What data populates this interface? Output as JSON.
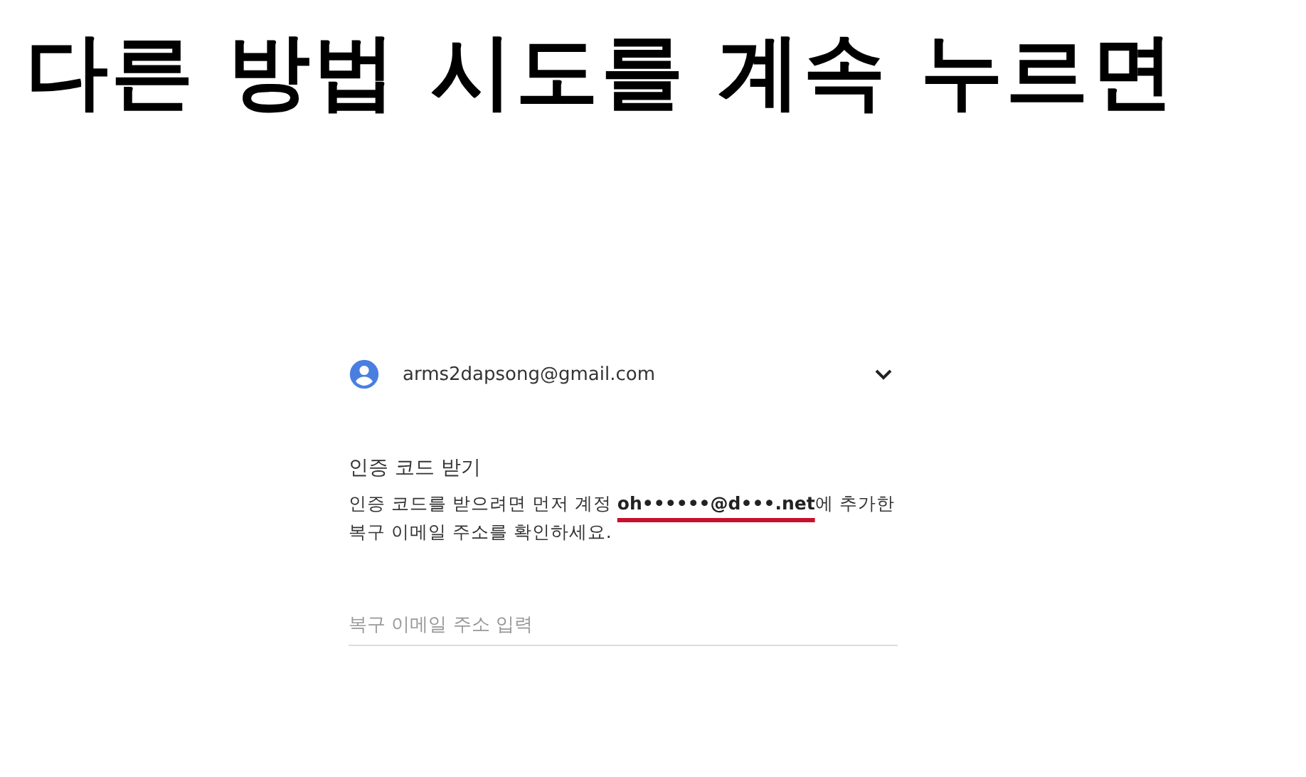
{
  "caption": "다른 방법 시도를 계속 누르면",
  "account": {
    "email": "arms2dapsong@gmail.com"
  },
  "heading": "인증 코드 받기",
  "description": "인증 코드를 받으려면 먼저 계정 **oh••••••@d•••.net**에 추가한 복구 이메일 주소를 확인하세요.",
  "recovery_email_field": {
    "placeholder": "복구 이메일 주소 입력"
  }
}
